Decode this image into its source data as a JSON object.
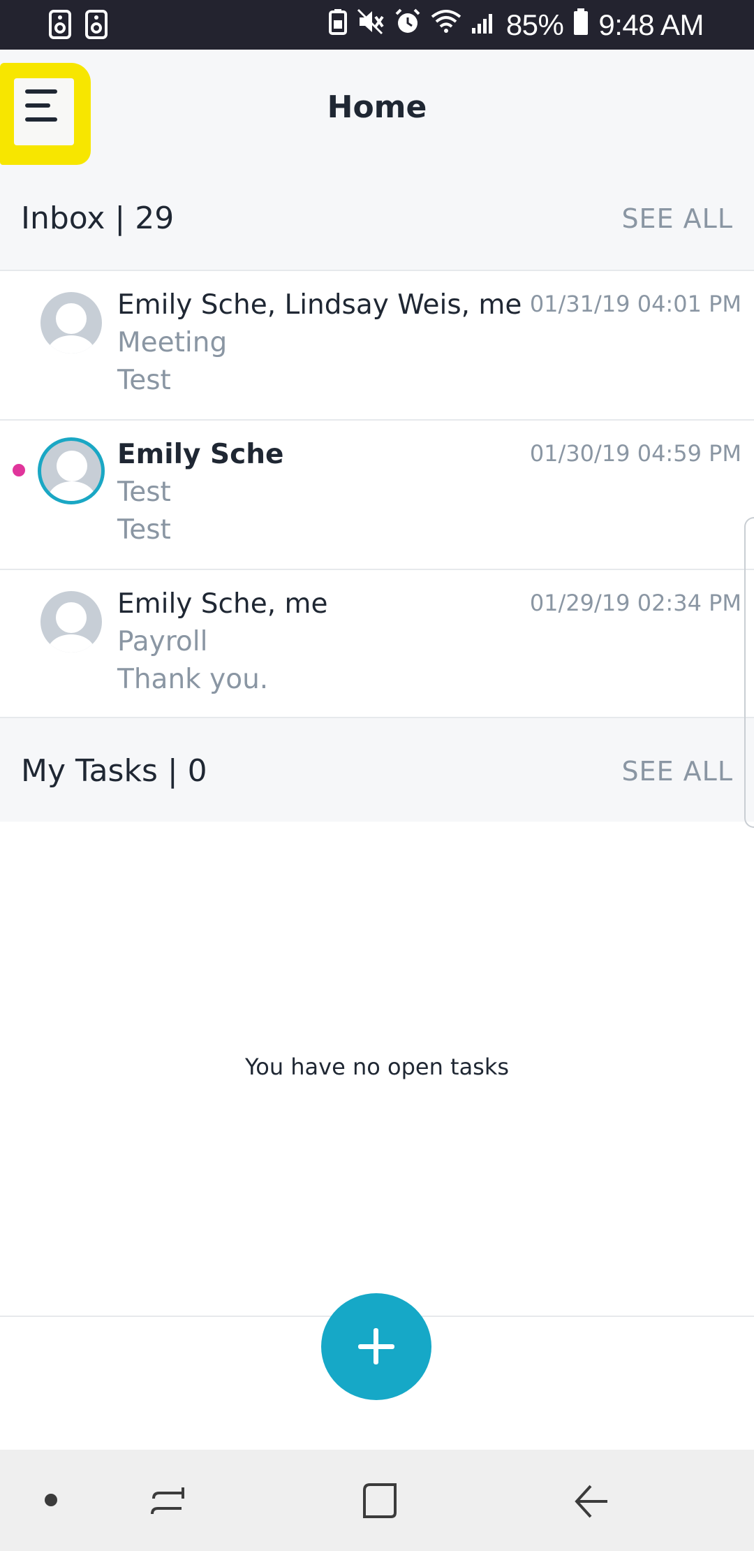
{
  "status_bar": {
    "battery_percent": "85%",
    "time": "9:48 AM",
    "left_icons": [
      "notification-icon",
      "notification-icon"
    ],
    "right_icons": [
      "battery-saver-icon",
      "mute-icon",
      "alarm-icon",
      "wifi-icon",
      "signal-icon",
      "battery-icon"
    ]
  },
  "header": {
    "title": "Home",
    "menu_icon": "hamburger-menu-icon",
    "highlight_color": "#f7e600"
  },
  "inbox": {
    "title": "Inbox | 29",
    "see_all": "SEE ALL",
    "messages": [
      {
        "sender": "Emily Sche, Lindsay Weis, me",
        "subject": "Meeting",
        "preview": "Test",
        "timestamp": "01/31/19 04:01 PM",
        "unread": false
      },
      {
        "sender": "Emily Sche",
        "subject": "Test",
        "preview": "Test",
        "timestamp": "01/30/19 04:59 PM",
        "unread": true
      },
      {
        "sender": "Emily Sche, me",
        "subject": "Payroll",
        "preview": "Thank you.",
        "timestamp": "01/29/19 02:34 PM",
        "unread": false
      }
    ]
  },
  "tasks": {
    "title": "My Tasks | 0",
    "see_all": "SEE ALL",
    "empty_message": "You have no open tasks"
  },
  "fab": {
    "icon": "plus-icon",
    "color": "#16a8c7"
  },
  "colors": {
    "accent": "#16a8c7",
    "unread_dot": "#e0359b",
    "muted_text": "#8a96a3",
    "primary_text": "#1f2733"
  },
  "nav_bar": {
    "icons": [
      "dot-icon",
      "recent-apps-icon",
      "home-icon",
      "back-icon"
    ]
  }
}
